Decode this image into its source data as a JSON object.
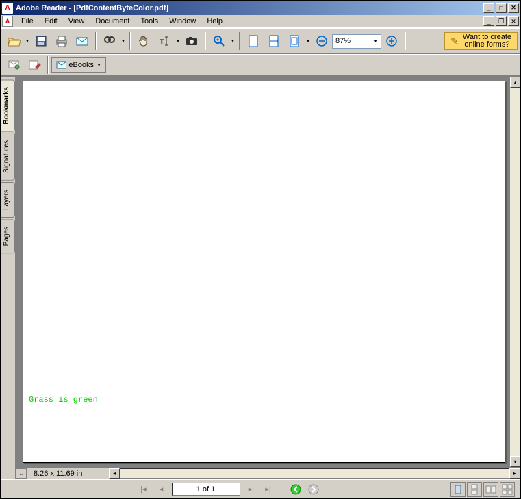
{
  "window": {
    "app_name": "Adobe Reader",
    "doc_name": "[PdfContentByteColor.pdf]"
  },
  "menu": {
    "file": "File",
    "edit": "Edit",
    "view": "View",
    "document": "Document",
    "tools": "Tools",
    "window": "Window",
    "help": "Help"
  },
  "toolbar": {
    "zoom_value": "87%",
    "ebooks_label": "eBooks"
  },
  "promo": {
    "line1": "Want to create",
    "line2": "online forms?"
  },
  "sidebar": {
    "tabs": [
      "Bookmarks",
      "Signatures",
      "Layers",
      "Pages"
    ]
  },
  "document": {
    "sample_text": "Grass is green",
    "page_size": "8.26 x 11.69 in"
  },
  "nav": {
    "page_indicator": "1 of 1"
  }
}
